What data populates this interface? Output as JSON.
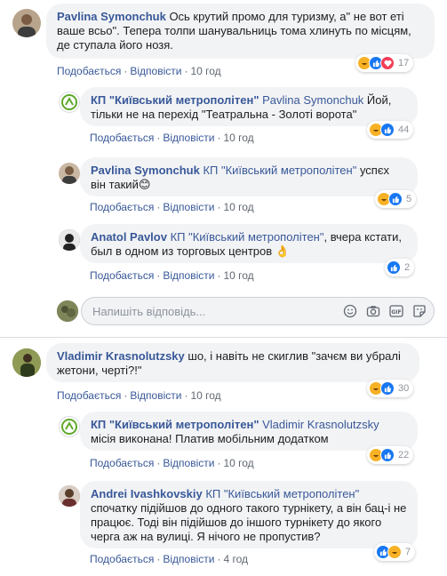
{
  "comments": [
    {
      "author": "Pavlina Symonchuk",
      "text": " Ось крутий промо для туризму, а\" не вот еті ваше всьо\". Тепера толпи шанувальниць тома хлинуть по місцям, де ступала його нозя.",
      "like_label": "Подобається",
      "reply_label": "Відповісти",
      "time": "10 год",
      "reaction_count": "17",
      "replies": [
        {
          "author": "КП \"Київський метрополітен\"",
          "mention": " Pavlina Symonchuk",
          "text": " Йой, тільки не на перехід \"Театральна - Золоті ворота\"",
          "like_label": "Подобається",
          "reply_label": "Відповісти",
          "time": "10 год",
          "reaction_count": "44"
        },
        {
          "author": "Pavlina Symonchuk",
          "mention": " КП \"Київський метрополітен\"",
          "text": " успєх він такий😊",
          "like_label": "Подобається",
          "reply_label": "Відповісти",
          "time": "10 год",
          "reaction_count": "5"
        },
        {
          "author": "Anatol Pavlov",
          "mention": " КП \"Київський метрополітен\"",
          "text": ", вчера кстати, был в одном из торговых центров 👌",
          "like_label": "Подобається",
          "reply_label": "Відповісти",
          "time": "10 год",
          "reaction_count": "2"
        }
      ]
    },
    {
      "author": "Vladimir Krasnolutzsky",
      "text": " шо, і навіть не скиглив \"зачєм ви убралі жетони, чертi?!\"",
      "like_label": "Подобається",
      "reply_label": "Відповісти",
      "time": "10 год",
      "reaction_count": "30",
      "replies": [
        {
          "author": "КП \"Київський метрополітен\"",
          "mention": " Vladimir Krasnolutzsky",
          "text": " місія виконана! Платив мобільним додатком",
          "like_label": "Подобається",
          "reply_label": "Відповісти",
          "time": "10 год",
          "reaction_count": "22"
        },
        {
          "author": "Andrei Ivashkovskiy",
          "mention": " КП \"Київський метрополітен\"",
          "text": " спочатку підійшов до одного такого турнікету, а він бац-і не працює. Тоді він підійшов до іншого турнікету до якого черга аж на вулиці. Я нічого не пропустив?",
          "like_label": "Подобається",
          "reply_label": "Відповісти",
          "time": "4 год",
          "reaction_count": "7"
        }
      ]
    }
  ],
  "reply_box": {
    "placeholder": "Напишіть відповідь..."
  },
  "icons": {
    "reactions": [
      "haha-icon",
      "like-icon",
      "love-icon"
    ],
    "reply_box": [
      "emoji-icon",
      "camera-icon",
      "gif-icon",
      "sticker-icon"
    ]
  },
  "colors": {
    "link": "#385898",
    "bubble": "#f2f3f5",
    "like": "#1877f2",
    "haha": "#f7b125",
    "love": "#f33e58"
  }
}
